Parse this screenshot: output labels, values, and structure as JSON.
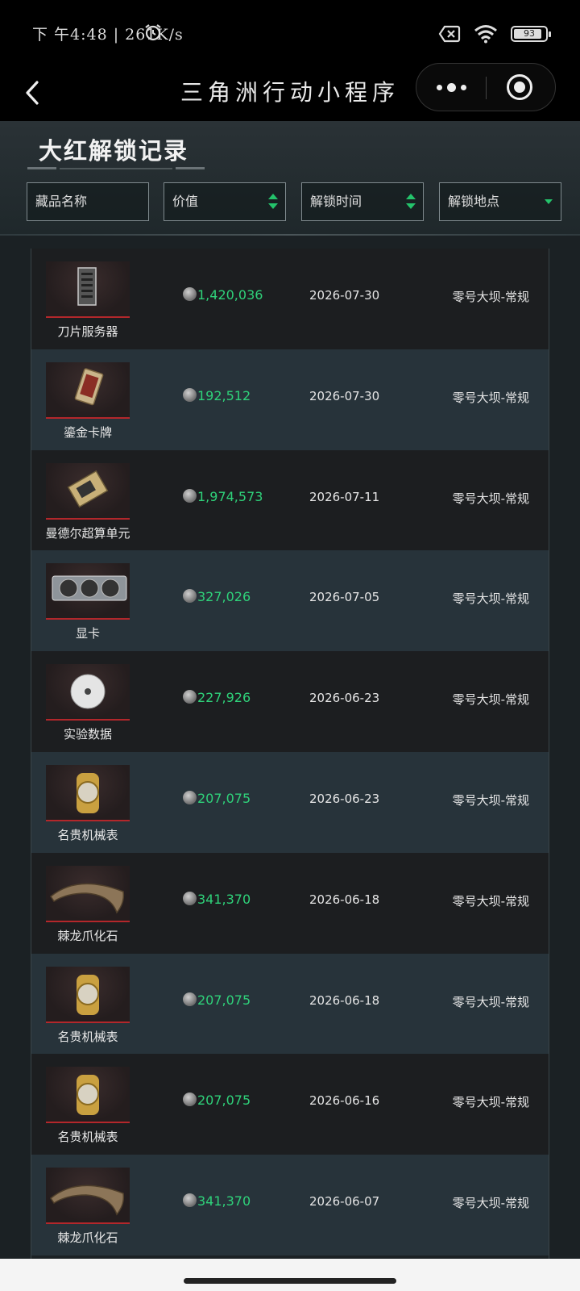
{
  "status_bar": {
    "time": "下 午4:48 | 261K/s",
    "battery": "93"
  },
  "nav": {
    "title": "三角洲行动小程序"
  },
  "page": {
    "title": "大红解锁记录"
  },
  "filters": {
    "name": "藏品名称",
    "value": "价值",
    "time": "解锁时间",
    "location": "解锁地点"
  },
  "records": [
    {
      "name": "刀片服务器",
      "value": "1,420,036",
      "date": "2026-07-30",
      "location": "零号大坝-常规",
      "icon": "server-icon"
    },
    {
      "name": "鎏金卡牌",
      "value": "192,512",
      "date": "2026-07-30",
      "location": "零号大坝-常规",
      "icon": "card-icon"
    },
    {
      "name": "曼德尔超算单元",
      "value": "1,974,573",
      "date": "2026-07-11",
      "location": "零号大坝-常规",
      "icon": "supercomputer-icon"
    },
    {
      "name": "显卡",
      "value": "327,026",
      "date": "2026-07-05",
      "location": "零号大坝-常规",
      "icon": "gpu-icon"
    },
    {
      "name": "实验数据",
      "value": "227,926",
      "date": "2026-06-23",
      "location": "零号大坝-常规",
      "icon": "disc-icon"
    },
    {
      "name": "名贵机械表",
      "value": "207,075",
      "date": "2026-06-23",
      "location": "零号大坝-常规",
      "icon": "watch-icon"
    },
    {
      "name": "棘龙爪化石",
      "value": "341,370",
      "date": "2026-06-18",
      "location": "零号大坝-常规",
      "icon": "claw-icon"
    },
    {
      "name": "名贵机械表",
      "value": "207,075",
      "date": "2026-06-18",
      "location": "零号大坝-常规",
      "icon": "watch-icon"
    },
    {
      "name": "名贵机械表",
      "value": "207,075",
      "date": "2026-06-16",
      "location": "零号大坝-常规",
      "icon": "watch-icon"
    },
    {
      "name": "棘龙爪化石",
      "value": "341,370",
      "date": "2026-06-07",
      "location": "零号大坝-常规",
      "icon": "claw-icon"
    }
  ]
}
